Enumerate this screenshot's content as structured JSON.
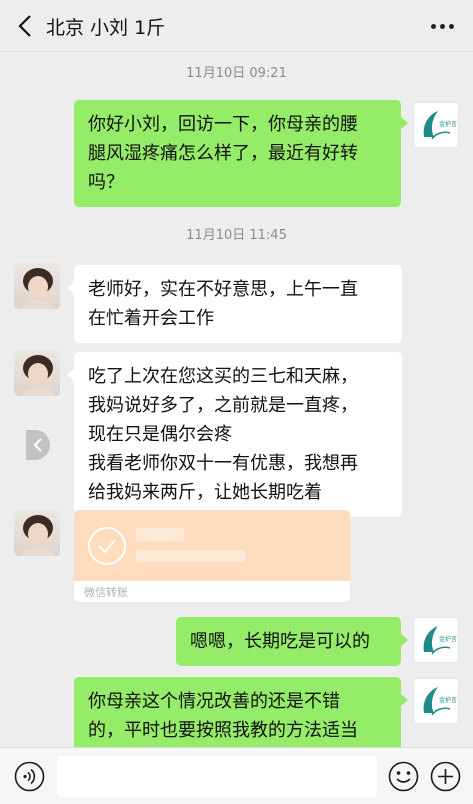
{
  "header": {
    "title": "北京 小刘 1斤",
    "back_icon": "chevron-left-icon",
    "more_icon": "more-dots-icon"
  },
  "messages": {
    "time1": "11月10日 09:21",
    "m1": [
      "你好小刘，回访一下，你母亲的腰",
      "腿风湿疼痛怎么样了，最近有好转",
      "吗？"
    ],
    "time2": "11月10日 11:45",
    "m2": [
      "老师好，实在不好意思，上午一直",
      "在忙着开会工作"
    ],
    "m3": [
      "吃了上次在您这买的三七和天麻，",
      "我妈说好多了，之前就是一直疼，",
      "现在只是偶尔会疼",
      "我看老师你双十一有优惠，我想再",
      "给我妈来两斤，让她长期吃着"
    ],
    "transfer_label": "微信转账",
    "m4": [
      "嗯嗯，长期吃是可以的"
    ],
    "m5": [
      "你母亲这个情况改善的还是不错",
      "的，平时也要按照我教的方法适当"
    ]
  },
  "logo_text": "金护言",
  "colors": {
    "my_bubble": "#95ec69",
    "their_bubble": "#ffffff",
    "background": "#ededed",
    "transfer": "#fcdcbd",
    "logo": "#1f8a8a"
  },
  "footer": {
    "voice_icon": "voice-icon",
    "emoji_icon": "emoji-icon",
    "plus_icon": "plus-icon"
  }
}
